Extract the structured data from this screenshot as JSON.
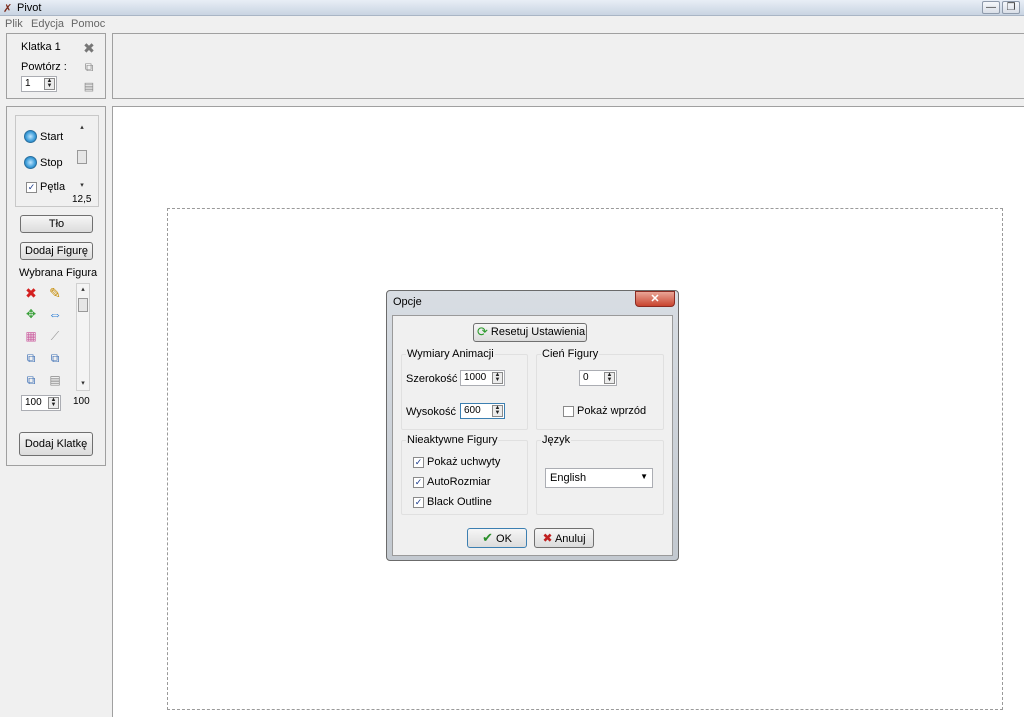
{
  "window": {
    "title": "Pivot",
    "min": "—",
    "max": "❐"
  },
  "menu": [
    "Plik",
    "Edycja",
    "Pomoc"
  ],
  "frame_panel": {
    "frame_label": "Klatka 1",
    "repeat_label": "Powtórz :",
    "repeat_value": "1"
  },
  "playback": {
    "start": "Start",
    "stop": "Stop",
    "loop": "Pętla",
    "loop_checked": "✓",
    "speed": "12,5"
  },
  "controls": {
    "background_button": "Tło",
    "add_figure_button": "Dodaj Figurę",
    "selected_figure_label": "Wybrana Figura",
    "scale_value": "100",
    "scale_readout": "100",
    "add_frame_button": "Dodaj Klatkę"
  },
  "dialog": {
    "title": "Opcje",
    "close": "✕",
    "reset_button": "Resetuj Ustawienia",
    "dimensions": {
      "title": "Wymiary Animacji",
      "width_label": "Szerokość",
      "width_value": "1000",
      "height_label": "Wysokość",
      "height_value": "600"
    },
    "shadow": {
      "title": "Cień Figury",
      "value": "0",
      "show_front_label": "Pokaż wprzód"
    },
    "inactive": {
      "title": "Nieaktywne Figury",
      "show_handles": "Pokaż uchwyty",
      "autosize": "AutoRozmiar",
      "black_outline": "Black Outline",
      "check": "✓"
    },
    "language": {
      "title": "Język",
      "value": "English"
    },
    "ok_button": "OK",
    "cancel_button": "Anuluj"
  },
  "icons": {
    "delete": "✖",
    "copy": "⧉",
    "paste": "📋",
    "play": "▶",
    "stop": "■",
    "red_x": "✖",
    "pencil": "✎",
    "move": "✥",
    "flip": "⇔",
    "palette": "▦",
    "tool": "⟋",
    "front": "⧉",
    "back": "⧉",
    "dup": "⧉",
    "clip": "▤",
    "reset": "⟳",
    "ok_check": "✔",
    "cancel_x": "✖",
    "up": "▲",
    "down": "▼",
    "caret": "▼"
  }
}
